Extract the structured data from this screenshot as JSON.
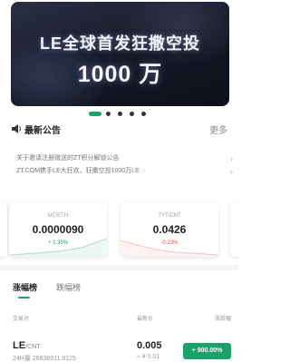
{
  "banner": {
    "line1": "LE全球首发狂撒空投",
    "line2": "1000 万"
  },
  "carousel": {
    "count": 5,
    "active_index": 0,
    "active_color": "#19a36a"
  },
  "announcements": {
    "title": "最新公告",
    "more_label": "更多",
    "items": [
      {
        "text": "关于邀请注册赠送的ZT积分解锁公告"
      },
      {
        "text": "ZT.COM携手LE大狂欢，狂撒空投1000万LE"
      }
    ]
  },
  "tickers": [
    {
      "pair": "MT/ETH",
      "price": "0.0000090",
      "change": "+ 1.35%",
      "trend": "up"
    },
    {
      "pair": "TYT/CNT",
      "price": "0.0426",
      "change": "-0.23%",
      "trend": "down"
    }
  ],
  "colors": {
    "up": "#19a36a",
    "down": "#e0464b",
    "accent": "#19a36a"
  },
  "market": {
    "tabs": [
      {
        "label": "涨幅榜",
        "active": true
      },
      {
        "label": "跌幅榜",
        "active": false
      }
    ],
    "columns": {
      "pair": "交易对",
      "latest": "最新价",
      "change": "涨跌幅"
    },
    "rows": [
      {
        "base": "LE",
        "quote": "/CNT",
        "volume": "24H量 26838911.9125",
        "price": "0.005",
        "price_cny": "≈ ¥ 0.01",
        "change": "+ 900.00%"
      }
    ]
  }
}
